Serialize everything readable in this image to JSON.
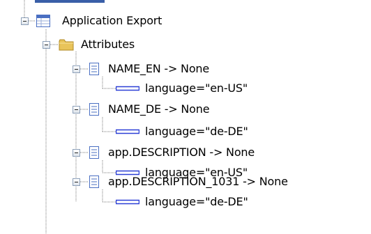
{
  "tree": {
    "root": {
      "label": "Application Export",
      "icon": "table-icon",
      "children": [
        {
          "label": "Attributes",
          "icon": "folder-icon",
          "children": [
            {
              "label": "NAME_EN -> None",
              "icon": "document-icon",
              "child": {
                "label": "language=\"en-US\"",
                "icon": "attribute-icon"
              }
            },
            {
              "label": "NAME_DE -> None",
              "icon": "document-icon",
              "child": {
                "label": "language=\"de-DE\"",
                "icon": "attribute-icon"
              }
            },
            {
              "label": "app.DESCRIPTION -> None",
              "icon": "document-icon",
              "child": {
                "label": "language=\"en-US\"",
                "icon": "attribute-icon"
              }
            },
            {
              "label": "app.DESCRIPTION_1031 -> None",
              "icon": "document-icon",
              "child": {
                "label": "language=\"de-DE\"",
                "icon": "attribute-icon"
              }
            }
          ]
        }
      ]
    }
  },
  "colors": {
    "tree_line": "#7a7a7a",
    "expander_border": "#8c9fb8",
    "attribute_icon": "#2b3fd6",
    "folder": "#e9c45a",
    "table_header": "#4a6fc2"
  }
}
